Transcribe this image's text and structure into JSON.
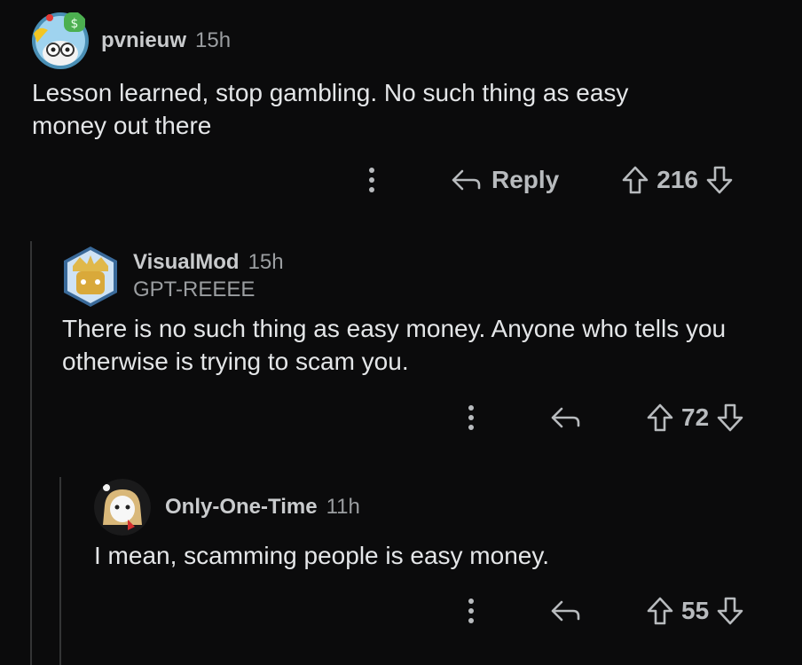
{
  "comments": [
    {
      "username": "pvnieuw",
      "time": "15h",
      "body": "Lesson learned, stop gambling. No such thing as easy money out there",
      "reply_label": "Reply",
      "score": "216"
    },
    {
      "username": "VisualMod",
      "time": "15h",
      "flair": "GPT-REEEE",
      "body": "There is no such thing as easy money. Anyone who tells you otherwise is trying to scam you.",
      "score": "72"
    },
    {
      "username": "Only-One-Time",
      "time": "11h",
      "body": "I mean, scamming people is easy money.",
      "score": "55"
    }
  ],
  "colors": {
    "background": "#0b0b0c",
    "thread_line": "#343536",
    "text": "#e4e6e8",
    "meta": "#9b9ea1"
  },
  "icons": [
    "more-vertical-icon",
    "reply-arrow-icon",
    "upvote-arrow-icon",
    "downvote-arrow-icon"
  ]
}
